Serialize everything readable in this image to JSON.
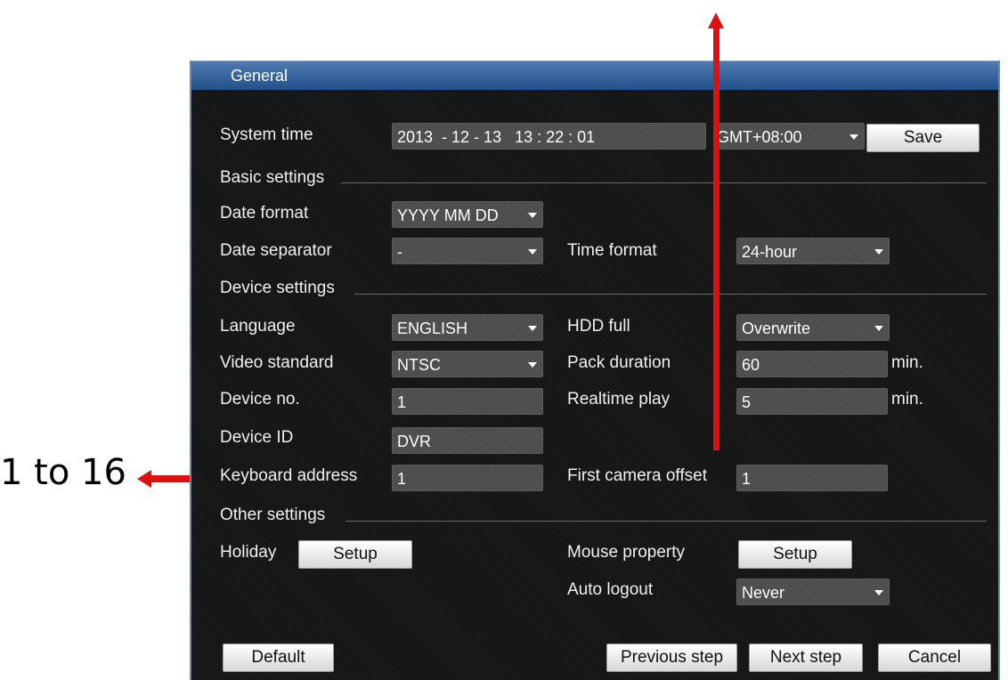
{
  "window": {
    "title": "General"
  },
  "system_time": {
    "label": "System time",
    "value": "2013  - 12 - 13   13 : 22 : 01",
    "timezone": "GMT+08:00",
    "save_label": "Save"
  },
  "sections": {
    "basic": "Basic settings",
    "device": "Device settings",
    "other": "Other settings"
  },
  "basic": {
    "date_format_label": "Date format",
    "date_format_value": "YYYY MM DD",
    "date_separator_label": "Date separator",
    "date_separator_value": "-",
    "time_format_label": "Time format",
    "time_format_value": "24-hour"
  },
  "device": {
    "language_label": "Language",
    "language_value": "ENGLISH",
    "hdd_full_label": "HDD full",
    "hdd_full_value": "Overwrite",
    "video_standard_label": "Video standard",
    "video_standard_value": "NTSC",
    "pack_duration_label": "Pack duration",
    "pack_duration_value": "60",
    "pack_duration_unit": "min.",
    "device_no_label": "Device no.",
    "device_no_value": "1",
    "realtime_play_label": "Realtime play",
    "realtime_play_value": "5",
    "realtime_play_unit": "min.",
    "device_id_label": "Device ID",
    "device_id_value": "DVR",
    "keyboard_address_label": "Keyboard address",
    "keyboard_address_value": "1",
    "first_camera_offset_label": "First camera offset",
    "first_camera_offset_value": "1"
  },
  "other": {
    "holiday_label": "Holiday",
    "holiday_button": "Setup",
    "mouse_property_label": "Mouse property",
    "mouse_property_button": "Setup",
    "auto_logout_label": "Auto logout",
    "auto_logout_value": "Never"
  },
  "footer": {
    "default_label": "Default",
    "previous_label": "Previous step",
    "next_label": "Next step",
    "cancel_label": "Cancel"
  },
  "annotation": {
    "text": "1 to 16",
    "color": "#e01010"
  }
}
